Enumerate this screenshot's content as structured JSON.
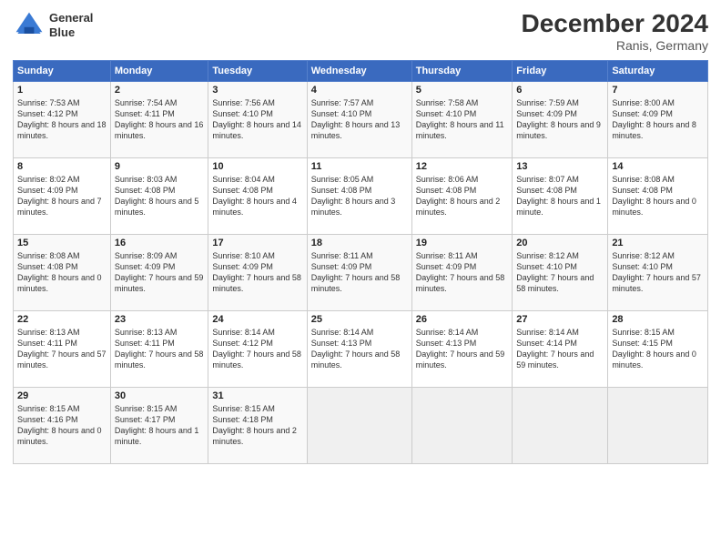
{
  "header": {
    "logo_line1": "General",
    "logo_line2": "Blue",
    "month": "December 2024",
    "location": "Ranis, Germany"
  },
  "days_of_week": [
    "Sunday",
    "Monday",
    "Tuesday",
    "Wednesday",
    "Thursday",
    "Friday",
    "Saturday"
  ],
  "weeks": [
    [
      {
        "day": "1",
        "info": "Sunrise: 7:53 AM\nSunset: 4:12 PM\nDaylight: 8 hours and 18 minutes."
      },
      {
        "day": "2",
        "info": "Sunrise: 7:54 AM\nSunset: 4:11 PM\nDaylight: 8 hours and 16 minutes."
      },
      {
        "day": "3",
        "info": "Sunrise: 7:56 AM\nSunset: 4:10 PM\nDaylight: 8 hours and 14 minutes."
      },
      {
        "day": "4",
        "info": "Sunrise: 7:57 AM\nSunset: 4:10 PM\nDaylight: 8 hours and 13 minutes."
      },
      {
        "day": "5",
        "info": "Sunrise: 7:58 AM\nSunset: 4:10 PM\nDaylight: 8 hours and 11 minutes."
      },
      {
        "day": "6",
        "info": "Sunrise: 7:59 AM\nSunset: 4:09 PM\nDaylight: 8 hours and 9 minutes."
      },
      {
        "day": "7",
        "info": "Sunrise: 8:00 AM\nSunset: 4:09 PM\nDaylight: 8 hours and 8 minutes."
      }
    ],
    [
      {
        "day": "8",
        "info": "Sunrise: 8:02 AM\nSunset: 4:09 PM\nDaylight: 8 hours and 7 minutes."
      },
      {
        "day": "9",
        "info": "Sunrise: 8:03 AM\nSunset: 4:08 PM\nDaylight: 8 hours and 5 minutes."
      },
      {
        "day": "10",
        "info": "Sunrise: 8:04 AM\nSunset: 4:08 PM\nDaylight: 8 hours and 4 minutes."
      },
      {
        "day": "11",
        "info": "Sunrise: 8:05 AM\nSunset: 4:08 PM\nDaylight: 8 hours and 3 minutes."
      },
      {
        "day": "12",
        "info": "Sunrise: 8:06 AM\nSunset: 4:08 PM\nDaylight: 8 hours and 2 minutes."
      },
      {
        "day": "13",
        "info": "Sunrise: 8:07 AM\nSunset: 4:08 PM\nDaylight: 8 hours and 1 minute."
      },
      {
        "day": "14",
        "info": "Sunrise: 8:08 AM\nSunset: 4:08 PM\nDaylight: 8 hours and 0 minutes."
      }
    ],
    [
      {
        "day": "15",
        "info": "Sunrise: 8:08 AM\nSunset: 4:08 PM\nDaylight: 8 hours and 0 minutes."
      },
      {
        "day": "16",
        "info": "Sunrise: 8:09 AM\nSunset: 4:09 PM\nDaylight: 7 hours and 59 minutes."
      },
      {
        "day": "17",
        "info": "Sunrise: 8:10 AM\nSunset: 4:09 PM\nDaylight: 7 hours and 58 minutes."
      },
      {
        "day": "18",
        "info": "Sunrise: 8:11 AM\nSunset: 4:09 PM\nDaylight: 7 hours and 58 minutes."
      },
      {
        "day": "19",
        "info": "Sunrise: 8:11 AM\nSunset: 4:09 PM\nDaylight: 7 hours and 58 minutes."
      },
      {
        "day": "20",
        "info": "Sunrise: 8:12 AM\nSunset: 4:10 PM\nDaylight: 7 hours and 58 minutes."
      },
      {
        "day": "21",
        "info": "Sunrise: 8:12 AM\nSunset: 4:10 PM\nDaylight: 7 hours and 57 minutes."
      }
    ],
    [
      {
        "day": "22",
        "info": "Sunrise: 8:13 AM\nSunset: 4:11 PM\nDaylight: 7 hours and 57 minutes."
      },
      {
        "day": "23",
        "info": "Sunrise: 8:13 AM\nSunset: 4:11 PM\nDaylight: 7 hours and 58 minutes."
      },
      {
        "day": "24",
        "info": "Sunrise: 8:14 AM\nSunset: 4:12 PM\nDaylight: 7 hours and 58 minutes."
      },
      {
        "day": "25",
        "info": "Sunrise: 8:14 AM\nSunset: 4:13 PM\nDaylight: 7 hours and 58 minutes."
      },
      {
        "day": "26",
        "info": "Sunrise: 8:14 AM\nSunset: 4:13 PM\nDaylight: 7 hours and 59 minutes."
      },
      {
        "day": "27",
        "info": "Sunrise: 8:14 AM\nSunset: 4:14 PM\nDaylight: 7 hours and 59 minutes."
      },
      {
        "day": "28",
        "info": "Sunrise: 8:15 AM\nSunset: 4:15 PM\nDaylight: 8 hours and 0 minutes."
      }
    ],
    [
      {
        "day": "29",
        "info": "Sunrise: 8:15 AM\nSunset: 4:16 PM\nDaylight: 8 hours and 0 minutes."
      },
      {
        "day": "30",
        "info": "Sunrise: 8:15 AM\nSunset: 4:17 PM\nDaylight: 8 hours and 1 minute."
      },
      {
        "day": "31",
        "info": "Sunrise: 8:15 AM\nSunset: 4:18 PM\nDaylight: 8 hours and 2 minutes."
      },
      null,
      null,
      null,
      null
    ]
  ]
}
